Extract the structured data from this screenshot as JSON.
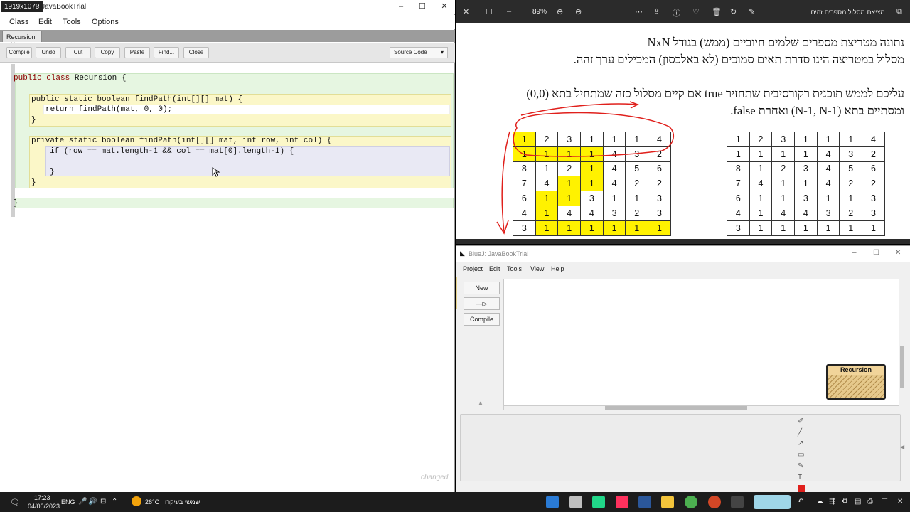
{
  "editor": {
    "screen_dims": "1919x1079",
    "title": "- JavaBookTrial",
    "menu": [
      "Class",
      "Edit",
      "Tools",
      "Options"
    ],
    "tab_label": "Recursion",
    "toolbar": [
      "Compile",
      "Undo",
      "Cut",
      "Copy",
      "Paste",
      "Find...",
      "Close"
    ],
    "view_select": "Source Code",
    "code": {
      "line1": "public class Recursion {",
      "line2a": "public static boolean findPath(int[][] mat) {",
      "line2b": "return findPath(mat, 0, 0);",
      "line2c": "}",
      "line3a": "private static boolean findPath(int[][] mat, int row, int col) {",
      "line3b": "if (row == mat.length-1 && col == mat[0].length-1) {",
      "line3c": "}",
      "line3d": "}",
      "line4": "}"
    },
    "status": "changed"
  },
  "pdf": {
    "zoom": "89%",
    "filename": "מציאת מסלול מספרים זהים...",
    "lines": [
      "נתונה מטריצת מספרים שלמים חיוביים (ממש) בגודל NxN",
      "מסלול במטריצה הינו סדרת תאים סמוכים (לא באלכסון) המכילים ערך זהה.",
      "עליכם לממש תוכנית רקורסיבית שתחזיר true אם קיים מסלול כזה שמתחיל בתא (0,0)",
      "ומסתיים בתא (N-1, N-1) ואחרת false."
    ],
    "grid_left": [
      [
        1,
        2,
        3,
        1,
        1,
        1,
        4
      ],
      [
        1,
        1,
        1,
        1,
        4,
        3,
        2
      ],
      [
        8,
        1,
        2,
        1,
        4,
        5,
        6
      ],
      [
        7,
        4,
        1,
        1,
        4,
        2,
        2
      ],
      [
        6,
        1,
        1,
        3,
        1,
        1,
        3
      ],
      [
        4,
        1,
        4,
        4,
        3,
        2,
        3
      ],
      [
        3,
        1,
        1,
        1,
        1,
        1,
        1
      ]
    ],
    "grid_right": [
      [
        1,
        2,
        3,
        1,
        1,
        1,
        4
      ],
      [
        1,
        1,
        1,
        1,
        4,
        3,
        2
      ],
      [
        8,
        1,
        2,
        3,
        4,
        5,
        6
      ],
      [
        7,
        4,
        1,
        1,
        4,
        2,
        2
      ],
      [
        6,
        1,
        1,
        3,
        1,
        1,
        3
      ],
      [
        4,
        1,
        4,
        4,
        3,
        2,
        3
      ],
      [
        3,
        1,
        1,
        1,
        1,
        1,
        1
      ]
    ],
    "highlighted_cells": [
      [
        0,
        0
      ],
      [
        1,
        0
      ],
      [
        1,
        1
      ],
      [
        1,
        2
      ],
      [
        1,
        3
      ],
      [
        2,
        3
      ],
      [
        3,
        2
      ],
      [
        3,
        3
      ],
      [
        4,
        1
      ],
      [
        4,
        2
      ],
      [
        5,
        1
      ],
      [
        6,
        1
      ],
      [
        6,
        2
      ],
      [
        6,
        3
      ],
      [
        6,
        4
      ],
      [
        6,
        5
      ],
      [
        6,
        6
      ]
    ],
    "highlight_color": "#fff200",
    "annotation_color": "#e0201c"
  },
  "bluej": {
    "title": "BlueJ: JavaBookTrial",
    "menu": [
      "Project",
      "Edit",
      "Tools",
      "View",
      "Help"
    ],
    "buttons": {
      "new_class": "New Class...",
      "compile": "Compile"
    },
    "class_name": "Recursion"
  },
  "taskbar": {
    "time": "17:23",
    "date": "04/06/2023",
    "lang": "ENG",
    "weather": "26°C",
    "weather_desc": "שמשי בעיקרו"
  }
}
